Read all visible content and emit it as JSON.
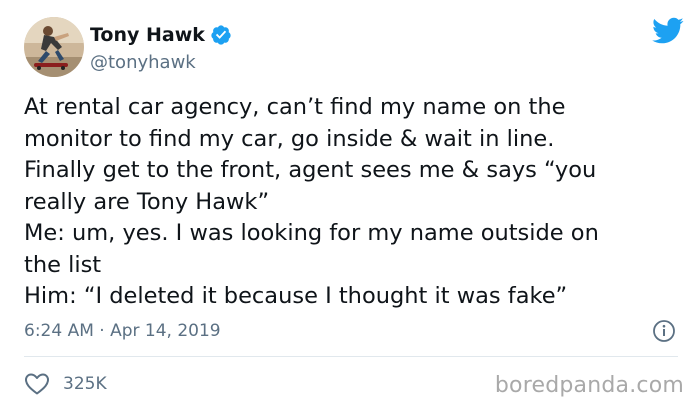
{
  "tweet": {
    "author": {
      "display_name": "Tony Hawk",
      "handle": "@tonyhawk",
      "verified": true,
      "avatar_icon": "skateboarder-avatar"
    },
    "text": "At rental car agency, can’t find my name on the\nmonitor to find my car, go inside & wait in line.\nFinally get to the front, agent sees me & says “you\nreally are Tony Hawk”\nMe: um, yes. I was looking for my name outside on\nthe list\nHim: “I deleted it because I thought it was fake”",
    "timestamp": "6:24 AM · Apr 14, 2019",
    "likes": "325K"
  },
  "icons": {
    "brand": "twitter-bird-icon",
    "verified": "verified-badge-icon",
    "info": "info-icon",
    "like": "heart-icon"
  },
  "colors": {
    "twitter_blue": "#1da1f2",
    "secondary_text": "#5b7083",
    "primary_text": "#0f1419",
    "divider": "#e1e8ed",
    "watermark": "#a9a9a9"
  },
  "watermark": {
    "text": "boredpanda.com"
  }
}
